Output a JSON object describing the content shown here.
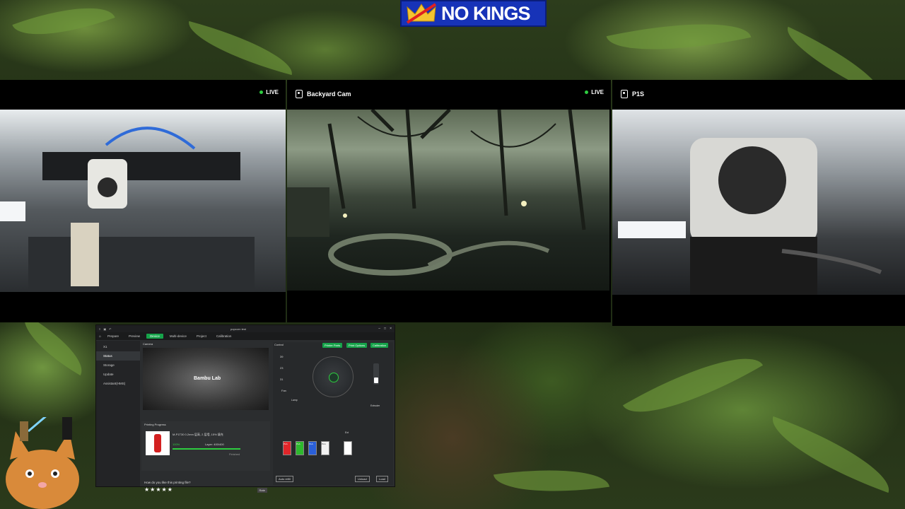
{
  "banner": {
    "text": "NO KINGS"
  },
  "cameras": [
    {
      "title": "",
      "live": "LIVE"
    },
    {
      "title": "Backyard Cam",
      "live": "LIVE"
    },
    {
      "title": "P1S",
      "live": ""
    }
  ],
  "bambu_app": {
    "window_title": "popcorn test",
    "tabs": [
      "Prepare",
      "Preview",
      "Device",
      "Multi-device",
      "Project",
      "Calibration"
    ],
    "active_tab": "Device",
    "printer": "X1",
    "sidebar": [
      "Status",
      "Storage",
      "Update",
      "Assistant(HMS)"
    ],
    "active_sidebar": "Status",
    "camera_label": "Bambu Lab",
    "camera_section": "Camera",
    "progress_section": "Printing Progress",
    "job_text": "M-P1T30 0.2mm 层高, 2 层墙, 15% 填充",
    "progress_percent": "100%",
    "layer_text": "Layer: 400/400",
    "progress_fraction": 1.0,
    "status_text": "Finished",
    "rating_prompt": "How do you like this printing file?",
    "rate_button": "Rate",
    "control_section": "Control",
    "control_buttons": [
      "Printer Parts",
      "Print Options",
      "Calibration"
    ],
    "temps": [
      "39",
      "23",
      "31"
    ],
    "fan_label": "Fan",
    "lamp_label": "Lamp",
    "extruder_label": "Extruder",
    "ext_label": "Ext",
    "spools": [
      {
        "label": "PLA",
        "color": "#e0262a"
      },
      {
        "label": "PLA",
        "color": "#2eb82e"
      },
      {
        "label": "PLA",
        "color": "#2a5fd9"
      },
      {
        "label": "PLA",
        "color": "#f2f2f2"
      }
    ],
    "ams_label": "Auto refill",
    "unload_button": "Unload",
    "load_button": "Load"
  },
  "colors": {
    "accent": "#16a34a",
    "live": "#2ecc40",
    "banner": "#1733b8"
  }
}
